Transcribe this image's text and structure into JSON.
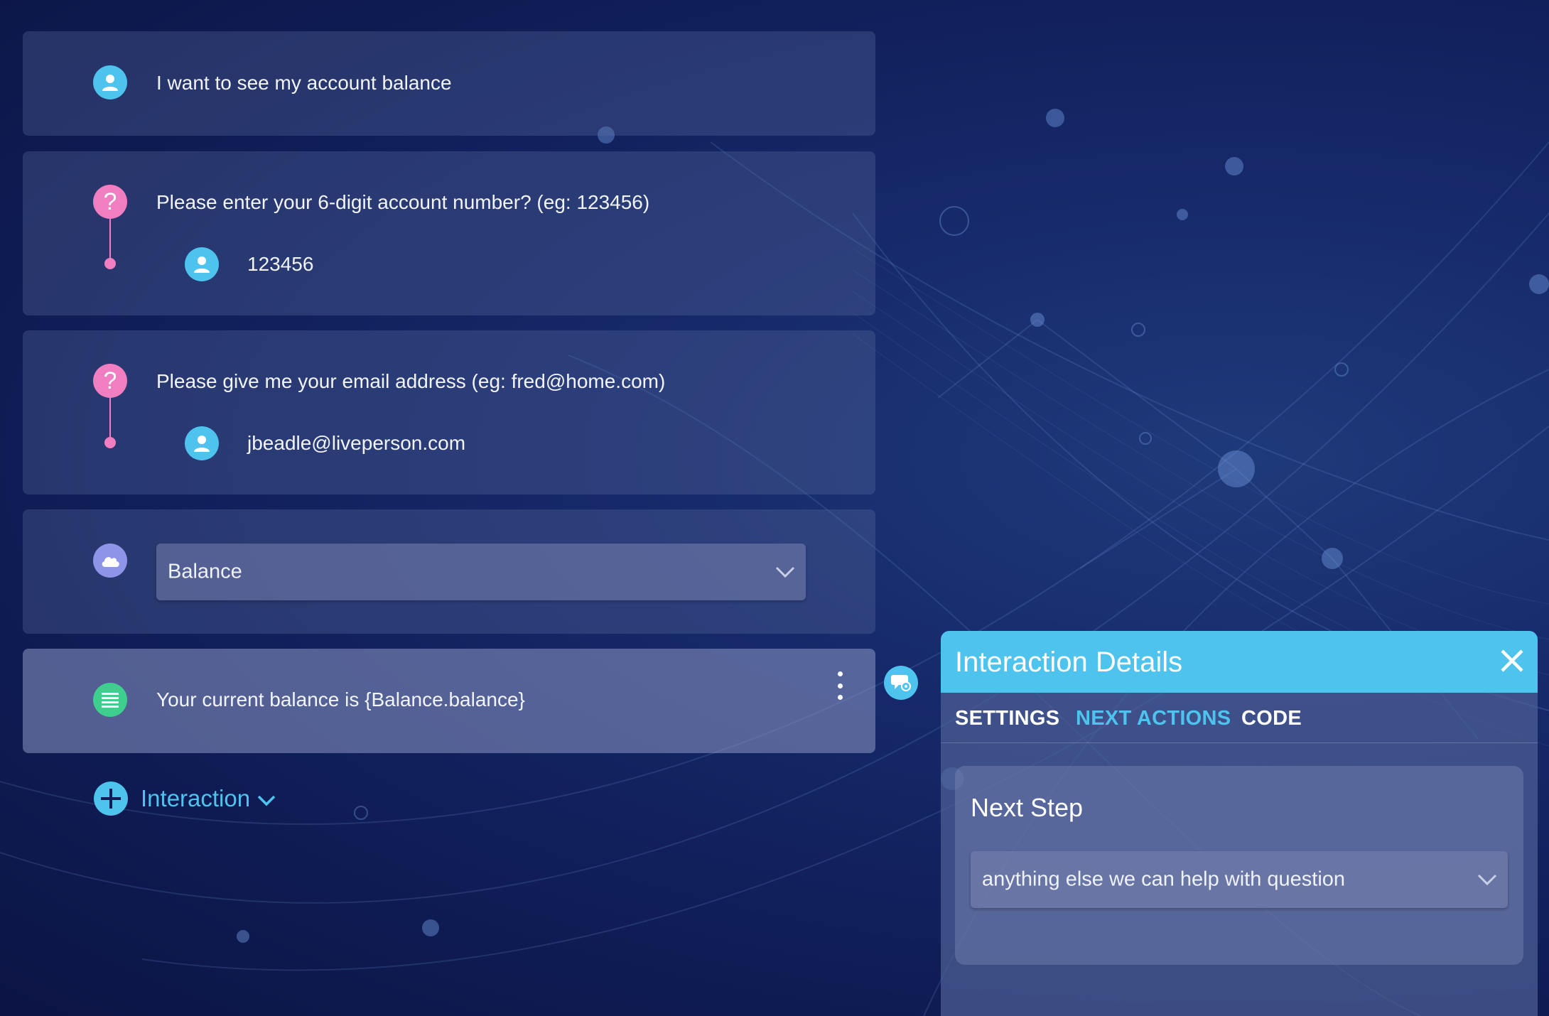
{
  "conversation": {
    "items": [
      {
        "type": "user",
        "text": "I want to see my account balance"
      },
      {
        "type": "question",
        "text": "Please enter your 6-digit account number? (eg: 123456)",
        "response": "123456"
      },
      {
        "type": "question",
        "text": "Please give me your email address (eg: fred@home.com)",
        "response": "jbeadle@liveperson.com"
      },
      {
        "type": "integration",
        "selected": "Balance"
      },
      {
        "type": "text",
        "text": "Your current balance is {Balance.balance}"
      }
    ],
    "add_label": "Interaction"
  },
  "panel": {
    "title": "Interaction Details",
    "tabs": [
      {
        "label": "SETTINGS",
        "active": false
      },
      {
        "label": "NEXT ACTIONS",
        "active": true
      },
      {
        "label": "CODE",
        "active": false
      }
    ],
    "next_step": {
      "label": "Next Step",
      "selected": "anything else we can help with question"
    }
  },
  "colors": {
    "accent": "#4ec3ee",
    "question": "#f07ec0",
    "integration": "#8e95e8",
    "text_statement": "#3ecf8e"
  },
  "icons": {
    "user": "user-icon",
    "question": "question-icon",
    "integration": "cloud-icon",
    "text": "text-lines-icon",
    "add": "plus-icon",
    "connector": "chat-gear-icon",
    "close": "close-icon",
    "menu": "kebab-menu-icon",
    "dropdown": "chevron-down-icon"
  }
}
